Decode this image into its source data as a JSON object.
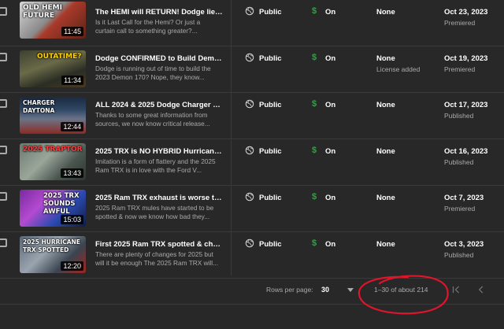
{
  "videos": [
    {
      "thumb_text": "OLD HEMI  FUTURE",
      "duration": "11:45",
      "title": "The HEMI will RETURN! Dodge lied ab...",
      "description": "Is it Last Call for the Hemi? Or just a curtain call to something greater?...",
      "visibility": "Public",
      "monetization": "On",
      "restrictions": "None",
      "restrictions_sub": "",
      "date": "Oct 23, 2023",
      "date_status": "Premiered"
    },
    {
      "thumb_text": "OUTATIME?",
      "duration": "11:34",
      "title": "Dodge CONFIRMED to Build Demon 1...",
      "description": "Dodge is running out of time to build the 2023 Demon 170? Nope, they know...",
      "visibility": "Public",
      "monetization": "On",
      "restrictions": "None",
      "restrictions_sub": "License added",
      "date": "Oct 19, 2023",
      "date_status": "Premiered"
    },
    {
      "thumb_text": "CHARGER DAYTONA",
      "duration": "12:44",
      "title": "ALL 2024 & 2025 Dodge Charger & Ch...",
      "description": "Thanks to some great information from sources, we now know critical release...",
      "visibility": "Public",
      "monetization": "On",
      "restrictions": "None",
      "restrictions_sub": "",
      "date": "Oct 17, 2023",
      "date_status": "Published"
    },
    {
      "thumb_text": "2025 TRAPTOR",
      "duration": "13:43",
      "title": "2025 TRX is NO HYBRID Hurricane Ra...",
      "description": "Imitation is a form of flattery and the 2025 Ram TRX is in love with the Ford V...",
      "visibility": "Public",
      "monetization": "On",
      "restrictions": "None",
      "restrictions_sub": "",
      "date": "Oct 16, 2023",
      "date_status": "Published"
    },
    {
      "thumb_text": "2025 TRX SOUNDS AWFUL",
      "duration": "15:03",
      "title": "2025 Ram TRX exhaust is worse than ...",
      "description": "2025 Ram TRX mules have started to be spotted & now we know how bad they...",
      "visibility": "Public",
      "monetization": "On",
      "restrictions": "None",
      "restrictions_sub": "",
      "date": "Oct 7, 2023",
      "date_status": "Premiered"
    },
    {
      "thumb_text": "2025 HURRICANE TRX SPOTTED",
      "duration": "12:20",
      "title": "First 2025 Ram TRX spotted & change...",
      "description": "There are plenty of changes for 2025 but will it be enough The 2025 Ram TRX will...",
      "visibility": "Public",
      "monetization": "On",
      "restrictions": "None",
      "restrictions_sub": "",
      "date": "Oct 3, 2023",
      "date_status": "Published"
    }
  ],
  "footer": {
    "rows_per_page_label": "Rows per page:",
    "rows_per_page_value": "30",
    "range_text": "1–30 of about 214"
  },
  "colors": {
    "background": "#282828",
    "monetization_green": "#2ba640",
    "annotation_red": "#e0142a"
  },
  "icons": [
    "checkbox",
    "globe-icon",
    "dollar-icon",
    "dropdown-caret-icon",
    "first-page-icon",
    "previous-page-icon"
  ]
}
